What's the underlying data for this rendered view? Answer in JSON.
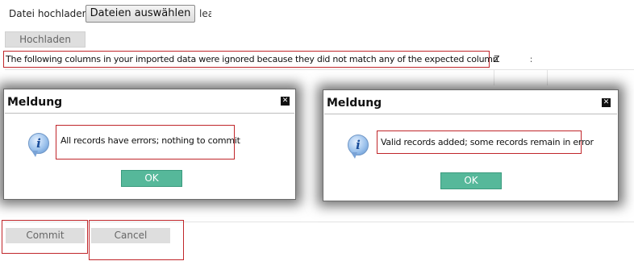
{
  "upload": {
    "label": "Datei hochladen:",
    "choose_button": "Dateien auswählen",
    "file_name_partial": "lea",
    "upload_button": "Hochladen"
  },
  "warning": {
    "text": "The following columns in your imported data were ignored because they did not match any of the expected column names:",
    "value_partial": "Z"
  },
  "dialogs": [
    {
      "title": "Meldung",
      "message": "All records have errors; nothing to commit",
      "ok_label": "OK",
      "icon": "info-icon",
      "close_icon": "close-icon"
    },
    {
      "title": "Meldung",
      "message": "Valid records added; some records remain in error",
      "ok_label": "OK",
      "icon": "info-icon",
      "close_icon": "close-icon"
    }
  ],
  "actions": {
    "commit_label": "Commit",
    "cancel_label": "Cancel"
  },
  "colors": {
    "highlight_outline": "#c0262a",
    "ok_button": "#56b89a",
    "disabled_button": "#dedede"
  }
}
